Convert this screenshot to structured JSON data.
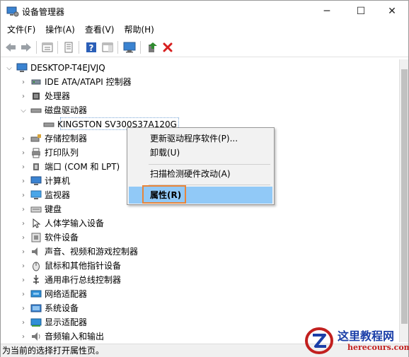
{
  "window": {
    "title": "设备管理器",
    "controls": {
      "minimize": "─",
      "maximize": "☐",
      "close": "✕"
    }
  },
  "menubar": {
    "items": [
      {
        "label": "文件(F)"
      },
      {
        "label": "操作(A)"
      },
      {
        "label": "查看(V)"
      },
      {
        "label": "帮助(H)"
      }
    ]
  },
  "toolbar": {
    "buttons": [
      "back-icon",
      "forward-icon",
      "properties-view-icon",
      "show-hidden-icon",
      "help-icon",
      "action-pane-icon",
      "monitor-icon",
      "update-driver-icon",
      "uninstall-icon"
    ],
    "colors": {
      "green": "#2e8b2e",
      "red": "#d71f1f",
      "blue": "#1f5fbf"
    }
  },
  "tree": {
    "root": "DESKTOP-T4EJVJQ",
    "categories": [
      {
        "label": "IDE ATA/ATAPI 控制器",
        "icon": "ide-controller-icon"
      },
      {
        "label": "处理器",
        "icon": "processor-icon"
      },
      {
        "label": "磁盘驱动器",
        "icon": "disk-drive-icon",
        "expanded": true
      },
      {
        "label": "存储控制器",
        "icon": "storage-controller-icon"
      },
      {
        "label": "打印队列",
        "icon": "print-queue-icon"
      },
      {
        "label": "端口 (COM 和 LPT)",
        "icon": "port-icon"
      },
      {
        "label": "计算机",
        "icon": "computer-icon"
      },
      {
        "label": "监视器",
        "icon": "monitor-icon"
      },
      {
        "label": "键盘",
        "icon": "keyboard-icon"
      },
      {
        "label": "人体学输入设备",
        "icon": "hid-icon"
      },
      {
        "label": "软件设备",
        "icon": "software-device-icon"
      },
      {
        "label": "声音、视频和游戏控制器",
        "icon": "sound-icon"
      },
      {
        "label": "鼠标和其他指针设备",
        "icon": "mouse-icon"
      },
      {
        "label": "通用串行总线控制器",
        "icon": "usb-icon"
      },
      {
        "label": "网络适配器",
        "icon": "network-adapter-icon"
      },
      {
        "label": "系统设备",
        "icon": "system-device-icon"
      },
      {
        "label": "显示适配器",
        "icon": "display-adapter-icon"
      },
      {
        "label": "音频输入和输出",
        "icon": "audio-io-icon"
      }
    ],
    "disk_child": "KINGSTON SV300S37A120G"
  },
  "context_menu": {
    "items": [
      {
        "label": "更新驱动程序软件(P)..."
      },
      {
        "label": "卸载(U)"
      },
      {
        "label": "扫描检测硬件改动(A)"
      },
      {
        "label": "属性(R)"
      }
    ],
    "highlight_color": "#91c9f7",
    "annotation_color": "#e8853a"
  },
  "statusbar": {
    "text": "为当前的选择打开属性页。"
  },
  "watermark": {
    "cn": "这里教程网",
    "en": "herecours.com"
  }
}
